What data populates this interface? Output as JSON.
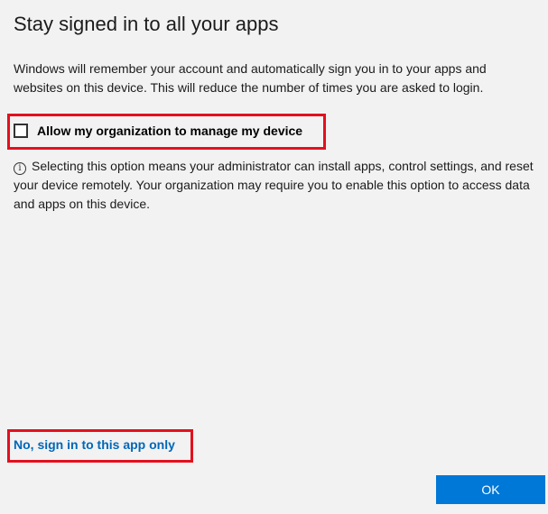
{
  "dialog": {
    "title": "Stay signed in to all your apps",
    "description": "Windows will remember your account and automatically sign you in to your apps and websites on this device. This will reduce the number of times you are asked to login.",
    "checkbox": {
      "label": "Allow my organization to manage my device",
      "checked": false
    },
    "info": {
      "icon": "info-icon",
      "icon_glyph": "i",
      "text": "Selecting this option means your administrator can install apps, control settings, and reset your device remotely. Your organization may require you to enable this option to access data and apps on this device."
    },
    "decline_link": "No, sign in to this app only",
    "ok_button": "OK"
  },
  "colors": {
    "background": "#f2f2f2",
    "highlight_border": "#e3101e",
    "link": "#0067b8",
    "primary_button": "#0078d7",
    "primary_button_text": "#ffffff"
  }
}
